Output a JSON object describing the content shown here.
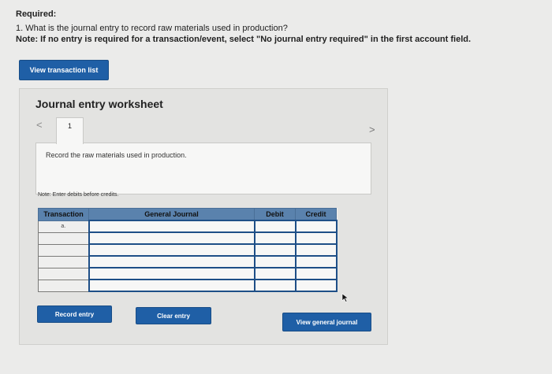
{
  "header": {
    "required": "Required:",
    "question": "1. What is the journal entry to record raw materials used in production?",
    "note": "Note: If no entry is required for a transaction/event, select \"No journal entry required\" in the first account field."
  },
  "buttons": {
    "view_transaction_list": "View transaction list",
    "record_entry": "Record entry",
    "clear_entry": "Clear entry",
    "view_general_journal": "View general journal"
  },
  "worksheet": {
    "title": "Journal entry worksheet",
    "prev": "<",
    "next": ">",
    "active_tab": "1",
    "entry_text": "Record the raw materials used in production.",
    "note": "Note: Enter debits before credits."
  },
  "table": {
    "headers": {
      "transaction": "Transaction",
      "account": "General Journal",
      "debit": "Debit",
      "credit": "Credit"
    },
    "rows": [
      {
        "transaction": "a.",
        "account": "",
        "debit": "",
        "credit": ""
      },
      {
        "transaction": "",
        "account": "",
        "debit": "",
        "credit": ""
      },
      {
        "transaction": "",
        "account": "",
        "debit": "",
        "credit": ""
      },
      {
        "transaction": "",
        "account": "",
        "debit": "",
        "credit": ""
      },
      {
        "transaction": "",
        "account": "",
        "debit": "",
        "credit": ""
      },
      {
        "transaction": "",
        "account": "",
        "debit": "",
        "credit": ""
      }
    ]
  },
  "colors": {
    "button": "#1f5fa6",
    "table_header": "#5a82ad",
    "cell_border": "#1e4f87"
  }
}
